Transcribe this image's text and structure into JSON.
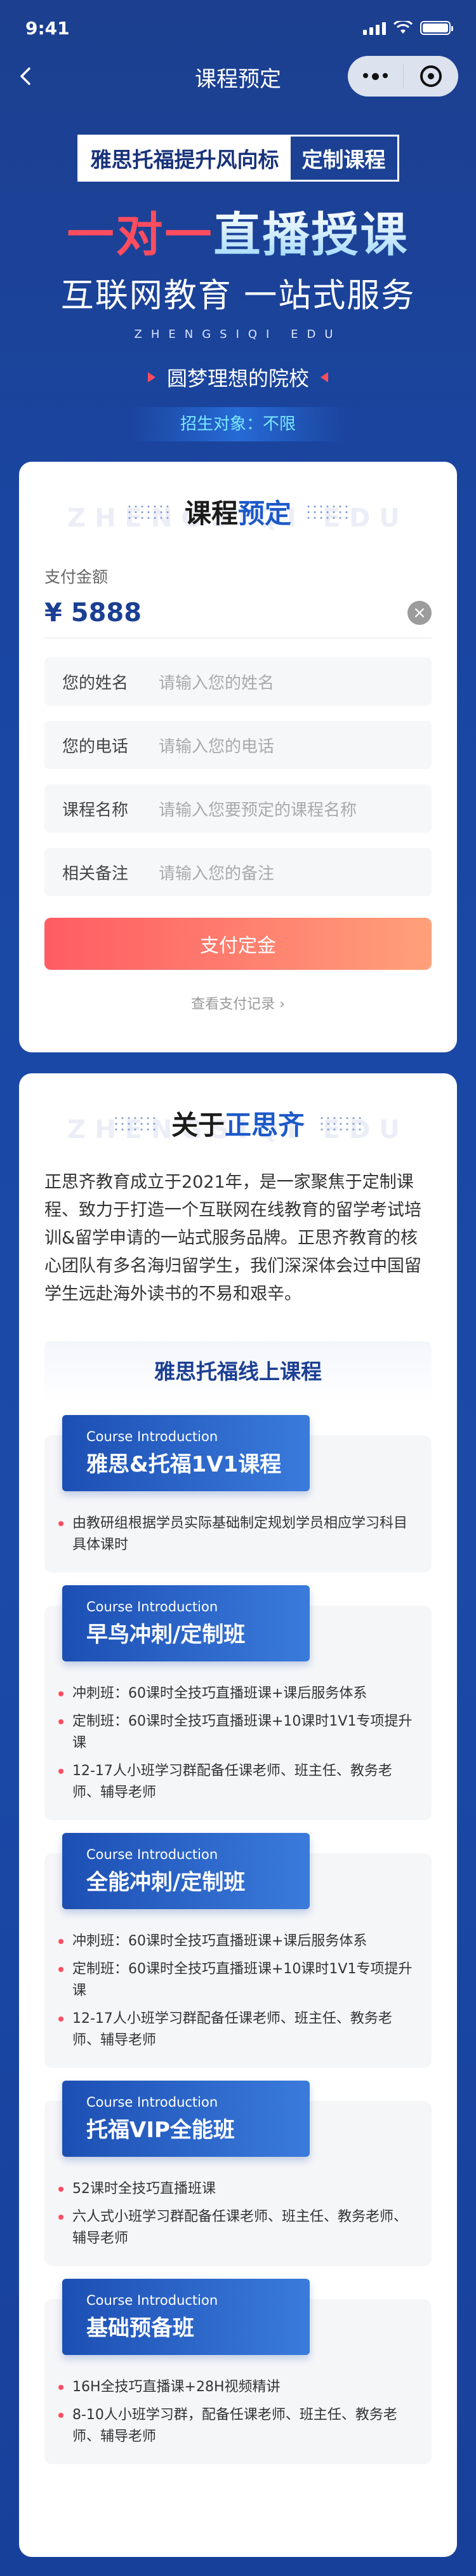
{
  "status_bar": {
    "time": "9:41"
  },
  "nav": {
    "title": "课程预定"
  },
  "hero": {
    "tag_left": "雅思托福提升风向标",
    "tag_right": "定制课程",
    "main_red": "一对一",
    "main_blue": "直播授课",
    "subtitle": "互联网教育 一站式服务",
    "pinyin": "ZHENGSIQI EDU",
    "slogan": "圆梦理想的院校",
    "target": "招生对象：不限"
  },
  "booking": {
    "title_plain": "课程",
    "title_accent": "预定",
    "watermark": "ZHENGSIQI EDU",
    "amount_label": "支付金额",
    "amount_value": "¥ 5888",
    "clear_icon": "×",
    "fields": [
      {
        "label": "您的姓名",
        "placeholder": "请输入您的姓名"
      },
      {
        "label": "您的电话",
        "placeholder": "请输入您的电话"
      },
      {
        "label": "课程名称",
        "placeholder": "请输入您要预定的课程名称"
      },
      {
        "label": "相关备注",
        "placeholder": "请输入您的备注"
      }
    ],
    "pay_button": "支付定金",
    "record_link": "查看支付记录 ›"
  },
  "about": {
    "title_plain": "关于",
    "title_accent": "正思齐",
    "watermark": "ZHENGSIQI EDU",
    "text": "正思齐教育成立于2021年，是一家聚焦于定制课程、致力于打造一个互联网在线教育的留学考试培训&留学申请的一站式服务品牌。正思齐教育的核心团队有多名海归留学生，我们深深体会过中国留学生远赴海外读书的不易和艰辛。",
    "courses_heading": "雅思托福线上课程",
    "courses": [
      {
        "en": "Course Introduction",
        "cn": "雅思&托福1V1课程",
        "items": [
          "由教研组根据学员实际基础制定规划学员相应学习科目具体课时"
        ]
      },
      {
        "en": "Course Introduction",
        "cn": "早鸟冲刺/定制班",
        "items": [
          "冲刺班：60课时全技巧直播班课+课后服务体系",
          "定制班：60课时全技巧直播班课+10课时1V1专项提升课",
          "12-17人小班学习群配备任课老师、班主任、教务老师、辅导老师"
        ]
      },
      {
        "en": "Course Introduction",
        "cn": "全能冲刺/定制班",
        "items": [
          "冲刺班：60课时全技巧直播班课+课后服务体系",
          "定制班：60课时全技巧直播班课+10课时1V1专项提升课",
          "12-17人小班学习群配备任课老师、班主任、教务老师、辅导老师"
        ]
      },
      {
        "en": "Course Introduction",
        "cn": "托福VIP全能班",
        "items": [
          "52课时全技巧直播班课",
          "六人式小班学习群配备任课老师、班主任、教务老师、辅导老师"
        ]
      },
      {
        "en": "Course Introduction",
        "cn": "基础预备班",
        "items": [
          "16H全技巧直播课+28H视频精讲",
          "8-10人小班学习群，配备任课老师、班主任、教务老师、辅导老师"
        ]
      }
    ]
  }
}
